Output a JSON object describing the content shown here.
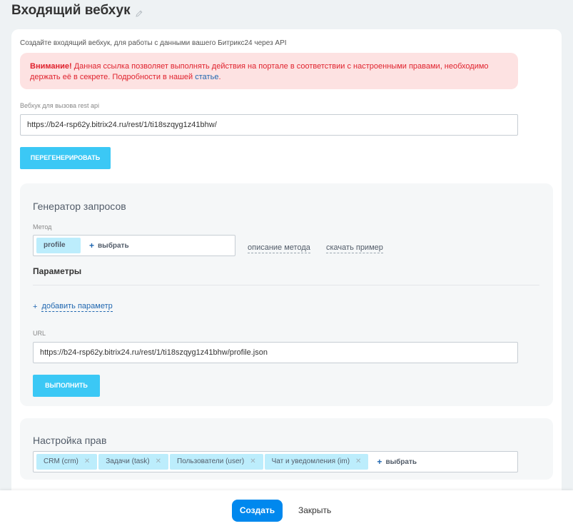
{
  "header": {
    "title": "Входящий вебхук"
  },
  "intro": "Создайте входящий вебхук, для работы с данными вашего Битрикс24 через API",
  "alert": {
    "prefix": "Внимание!",
    "text": " Данная ссылка позволяет выполнять действия на портале в соответствии с настроенными правами, необходимо держать её в секрете. Подробности в нашей ",
    "link": "статье",
    "suffix": "."
  },
  "webhook": {
    "label": "Вебхук для вызова rest api",
    "value": "https://b24-rsp62y.bitrix24.ru/rest/1/ti18szqyg1z41bhw/",
    "regenerate_label": "ПЕРЕГЕНЕРИРОВАТЬ"
  },
  "generator": {
    "title": "Генератор запросов",
    "method_label": "Метод",
    "method_tag": "profile",
    "select_label": "выбрать",
    "describe_link": "описание метода",
    "download_link": "скачать пример",
    "params_title": "Параметры",
    "add_param": "добавить параметр",
    "url_label": "URL",
    "url_value": "https://b24-rsp62y.bitrix24.ru/rest/1/ti18szqyg1z41bhw/profile.json",
    "run_label": "ВЫПОЛНИТЬ"
  },
  "rights": {
    "title": "Настройка прав",
    "tags": [
      "CRM (crm)",
      "Задачи (task)",
      "Пользователи (user)",
      "Чат и уведомления (im)"
    ],
    "select_label": "выбрать"
  },
  "footer": {
    "create_label": "Создать",
    "close_label": "Закрыть"
  },
  "icons": {
    "title_edit": "pencil-icon",
    "tag_remove": "close-icon",
    "add": "plus-icon"
  },
  "colors": {
    "accent": "#3bc8f5",
    "primary": "#0088ee",
    "alert_bg": "#fde2e2",
    "alert_text": "#e0232e",
    "link": "#2067b0"
  }
}
